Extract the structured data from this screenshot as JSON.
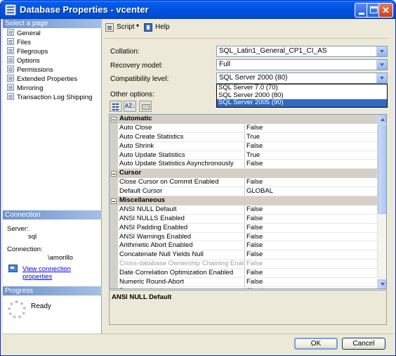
{
  "window": {
    "title": "Database Properties - vcenter"
  },
  "left": {
    "select_page_header": "Select a page",
    "pages": [
      "General",
      "Files",
      "Filegroups",
      "Options",
      "Permissions",
      "Extended Properties",
      "Mirroring",
      "Transaction Log Shipping"
    ],
    "connection_header": "Connection",
    "server_label": "Server:",
    "server_value": "sql",
    "connection_label": "Connection:",
    "connection_value": "\\amorillo",
    "view_link": "View connection properties",
    "progress_header": "Progress",
    "progress_status": "Ready"
  },
  "toolbar": {
    "script_label": "Script",
    "help_label": "Help"
  },
  "form": {
    "collation_label": "Collation:",
    "collation_value": "SQL_Latin1_General_CP1_CI_AS",
    "recovery_label": "Recovery model:",
    "recovery_value": "Full",
    "compat_label": "Compatibility level:",
    "compat_value": "SQL Server 2000 (80)",
    "compat_options": [
      "SQL Server 7.0 (70)",
      "SQL Server 2000 (80)",
      "SQL Server 2005 (90)"
    ],
    "other_options_label": "Other options:"
  },
  "grid": {
    "rows": [
      {
        "type": "cat",
        "name": "Automatic"
      },
      {
        "type": "prop",
        "name": "Auto Close",
        "value": "False"
      },
      {
        "type": "prop",
        "name": "Auto Create Statistics",
        "value": "True"
      },
      {
        "type": "prop",
        "name": "Auto Shrink",
        "value": "False"
      },
      {
        "type": "prop",
        "name": "Auto Update Statistics",
        "value": "True"
      },
      {
        "type": "prop",
        "name": "Auto Update Statistics Asynchronously",
        "value": "False"
      },
      {
        "type": "cat",
        "name": "Cursor"
      },
      {
        "type": "prop",
        "name": "Close Cursor on Commit Enabled",
        "value": "False"
      },
      {
        "type": "prop",
        "name": "Default Cursor",
        "value": "GLOBAL"
      },
      {
        "type": "cat",
        "name": "Miscellaneous"
      },
      {
        "type": "prop",
        "name": "ANSI NULL Default",
        "value": "False"
      },
      {
        "type": "prop",
        "name": "ANSI NULLS Enabled",
        "value": "False"
      },
      {
        "type": "prop",
        "name": "ANSI Padding Enabled",
        "value": "False"
      },
      {
        "type": "prop",
        "name": "ANSI Warnings Enabled",
        "value": "False"
      },
      {
        "type": "prop",
        "name": "Arithmetic Abort Enabled",
        "value": "False"
      },
      {
        "type": "prop",
        "name": "Concatenate Null Yields Null",
        "value": "False"
      },
      {
        "type": "prop",
        "name": "Cross-database Ownership Chaining Enabled",
        "value": "False",
        "disabled": true
      },
      {
        "type": "prop",
        "name": "Date Correlation Optimization Enabled",
        "value": "False"
      },
      {
        "type": "prop",
        "name": "Numeric Round-Abort",
        "value": "False"
      },
      {
        "type": "prop",
        "name": "Parameterization",
        "value": "Simple"
      }
    ]
  },
  "description": {
    "title": "ANSI NULL Default"
  },
  "buttons": {
    "ok": "OK",
    "cancel": "Cancel"
  }
}
